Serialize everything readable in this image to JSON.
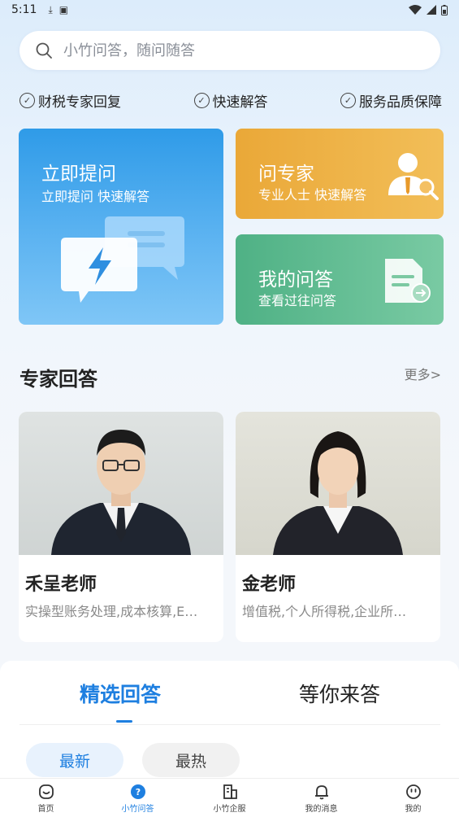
{
  "status_bar": {
    "time": "5:11"
  },
  "search": {
    "placeholder": "小竹问答，随问随答"
  },
  "features": [
    "财税专家回复",
    "快速解答",
    "服务品质保障"
  ],
  "cards": {
    "ask": {
      "title": "立即提问",
      "subtitle": "立即提问 快速解答"
    },
    "expert": {
      "title": "问专家",
      "subtitle": "专业人士 快速解答"
    },
    "mine": {
      "title": "我的问答",
      "subtitle": "查看过往问答"
    }
  },
  "experts_section": {
    "title": "专家回答",
    "more": "更多>"
  },
  "teachers": [
    {
      "name": "禾呈老师",
      "desc": "实操型账务处理,成本核算,E…"
    },
    {
      "name": "金老师",
      "desc": "增值税,个人所得税,企业所…"
    }
  ],
  "answer_tabs": {
    "active": "精选回答",
    "other": "等你来答"
  },
  "filter_pills": {
    "active": "最新",
    "other": "最热"
  },
  "nav": [
    {
      "label": "首页",
      "icon": "home-icon"
    },
    {
      "label": "小竹问答",
      "icon": "question-icon"
    },
    {
      "label": "小竹企服",
      "icon": "building-icon"
    },
    {
      "label": "我的消息",
      "icon": "bell-icon"
    },
    {
      "label": "我的",
      "icon": "profile-icon"
    }
  ],
  "colors": {
    "accent": "#1e7fe0",
    "ask_card": "#2f9be8",
    "expert_card": "#eaa838",
    "mine_card": "#4fb185"
  }
}
